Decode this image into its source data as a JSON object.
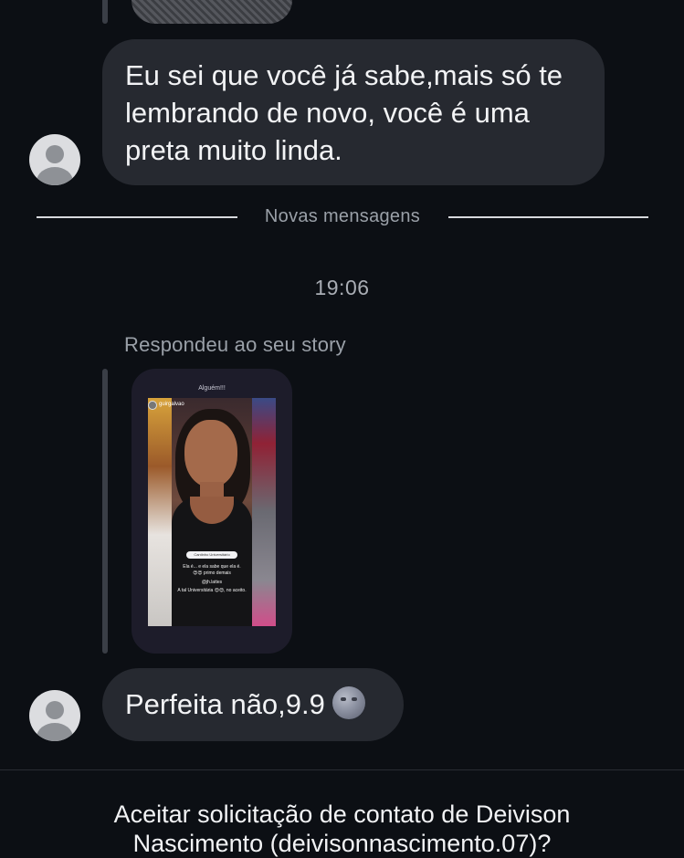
{
  "messages": {
    "first": {
      "text_line1": "Eu sei que você já sabe,mais só te",
      "text_line2": "lembrando de novo, você é uma",
      "text_line3": "preta muito linda."
    },
    "divider": {
      "label": "Novas mensagens"
    },
    "timestamp": "19:06",
    "story_reply": {
      "caption": "Respondeu ao seu story",
      "story_header": "Alguém!!!",
      "story_username": "guirgalvao",
      "story_location": "Cantinho Universitário",
      "story_text_1": "Ela é... e ela sabe que ela é.",
      "story_text_2": "😍😍 primo demais",
      "story_mention": "@jh.lattes",
      "story_text_3": "A tal Universitária 😍😍, no aceito."
    },
    "second": {
      "text": "Perfeita não,9.9",
      "emoji": "new-moon-face-icon"
    }
  },
  "footer": {
    "request_line1": "Aceitar solicitação de contato de Deivison",
    "request_line2": "Nascimento (deivisonnascimento.07)?"
  },
  "colors": {
    "background": "#0c0f14",
    "bubble": "#262930",
    "muted_text": "#9aa0a8",
    "text": "#f2f3f5"
  }
}
